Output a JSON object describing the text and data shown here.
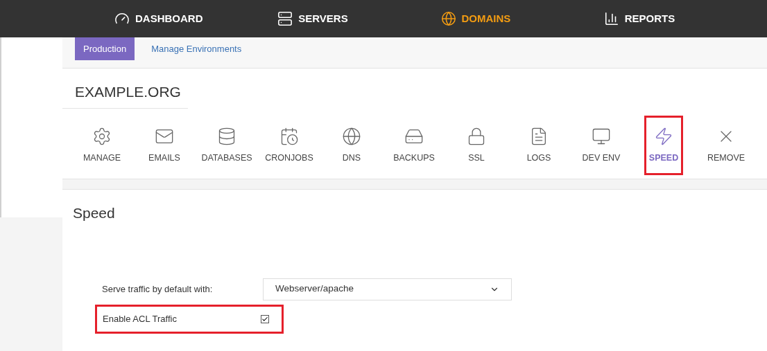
{
  "nav": [
    {
      "label": "DASHBOARD",
      "selected": false
    },
    {
      "label": "SERVERS",
      "selected": false
    },
    {
      "label": "DOMAINS",
      "selected": true
    },
    {
      "label": "REPORTS",
      "selected": false
    }
  ],
  "env_tabs": [
    {
      "label": "Production",
      "selected": true
    },
    {
      "label": "Manage Environments",
      "selected": false
    }
  ],
  "domain": {
    "title": "EXAMPLE.ORG"
  },
  "tools": [
    {
      "label": "MANAGE",
      "selected": false,
      "highlighted": false
    },
    {
      "label": "EMAILS",
      "selected": false,
      "highlighted": false
    },
    {
      "label": "DATABASES",
      "selected": false,
      "highlighted": false
    },
    {
      "label": "CRONJOBS",
      "selected": false,
      "highlighted": false
    },
    {
      "label": "DNS",
      "selected": false,
      "highlighted": false
    },
    {
      "label": "BACKUPS",
      "selected": false,
      "highlighted": false
    },
    {
      "label": "SSL",
      "selected": false,
      "highlighted": false
    },
    {
      "label": "LOGS",
      "selected": false,
      "highlighted": false
    },
    {
      "label": "DEV ENV",
      "selected": false,
      "highlighted": false
    },
    {
      "label": "SPEED",
      "selected": true,
      "highlighted": true
    },
    {
      "label": "REMOVE",
      "selected": false,
      "highlighted": false
    }
  ],
  "speed": {
    "title": "Speed",
    "serve_with": {
      "label": "Serve traffic by default with:",
      "value": "Webserver/apache"
    },
    "acl": {
      "label": "Enable ACL Traffic",
      "checked": true,
      "highlighted": true
    }
  }
}
